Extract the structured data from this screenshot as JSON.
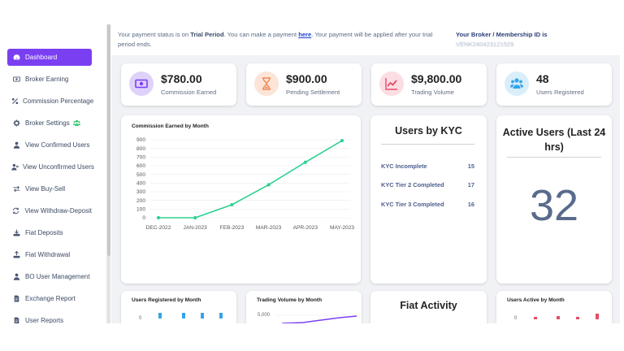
{
  "sidebar": {
    "items": [
      {
        "label": "Dashboard",
        "icon": "dashboard-gauge-icon",
        "active": true
      },
      {
        "label": "Broker Earning",
        "icon": "money-bill-icon",
        "active": false
      },
      {
        "label": "Commission Percentage",
        "icon": "percent-icon",
        "active": false
      },
      {
        "label": "Broker Settings",
        "icon": "gear-icon",
        "active": false
      },
      {
        "label": "View Confirmed Users",
        "icon": "user-icon",
        "active": false
      },
      {
        "label": "View Unconfirmed Users",
        "icon": "user-x-icon",
        "active": false
      },
      {
        "label": "View Buy-Sell",
        "icon": "exchange-arrows-icon",
        "active": false
      },
      {
        "label": "View Withdraw-Deposit",
        "icon": "sync-icon",
        "active": false
      },
      {
        "label": "Fiat Deposits",
        "icon": "download-tray-icon",
        "active": false
      },
      {
        "label": "Fiat Withdrawal",
        "icon": "upload-tray-icon",
        "active": false
      },
      {
        "label": "BO User Management",
        "icon": "user-icon",
        "active": false
      },
      {
        "label": "Exchange Report",
        "icon": "document-icon",
        "active": false
      },
      {
        "label": "User Reports",
        "icon": "document-icon",
        "active": false
      }
    ]
  },
  "notice": {
    "prefix": "Your payment status is on ",
    "status": "Trial Period",
    "middle": ". You can make a payment ",
    "link": "here",
    "suffix": ". Your payment will be applied after your trial period ends."
  },
  "broker": {
    "label": "Your Broker / Membership ID is",
    "id": "VENK240423121529"
  },
  "stats": [
    {
      "value": "$780.00",
      "label": "Commission Earned",
      "icon": "money-bill-icon",
      "color": "#7b3ff2",
      "bg": "#ded2fb"
    },
    {
      "value": "$900.00",
      "label": "Pending Settlement",
      "icon": "hourglass-icon",
      "color": "#f0884f",
      "bg": "#fde4d8"
    },
    {
      "value": "$9,800.00",
      "label": "Trading Volume",
      "icon": "line-chart-icon",
      "color": "#e44d6b",
      "bg": "#fcdde3"
    },
    {
      "value": "48",
      "label": "Users Registered",
      "icon": "users-icon",
      "color": "#35a4ea",
      "bg": "#d9eefb"
    }
  ],
  "commission_chart": {
    "title": "Commission Earned by Month",
    "line_color": "#2ed191"
  },
  "kyc": {
    "title": "Users by KYC",
    "rows": [
      {
        "label": "KYC Incomplete",
        "count": "15"
      },
      {
        "label": "KYC Tier 2 Completed",
        "count": "17"
      },
      {
        "label": "KYC Tier 3 Completed",
        "count": "16"
      }
    ]
  },
  "active_users": {
    "title": "Active Users (Last 24 hrs)",
    "count": "32"
  },
  "bottom": {
    "registered_title": "Users Registered by Month",
    "registered_tick": "0",
    "trading_title": "Trading Volume by Month",
    "trading_tick": "5,000",
    "fiat_title": "Fiat Activity",
    "active_title": "Users Active by Month",
    "active_tick": "0"
  },
  "chart_data": {
    "type": "line",
    "title": "Commission Earned by Month",
    "categories": [
      "DEC-2022",
      "JAN-2023",
      "FEB-2023",
      "MAR-2023",
      "APR-2023",
      "MAY-2023"
    ],
    "values": [
      0,
      0,
      150,
      380,
      640,
      890
    ],
    "ylim": [
      0,
      900
    ],
    "yticks": [
      0,
      100,
      200,
      300,
      400,
      500,
      600,
      700,
      800,
      900
    ],
    "grid": true
  }
}
